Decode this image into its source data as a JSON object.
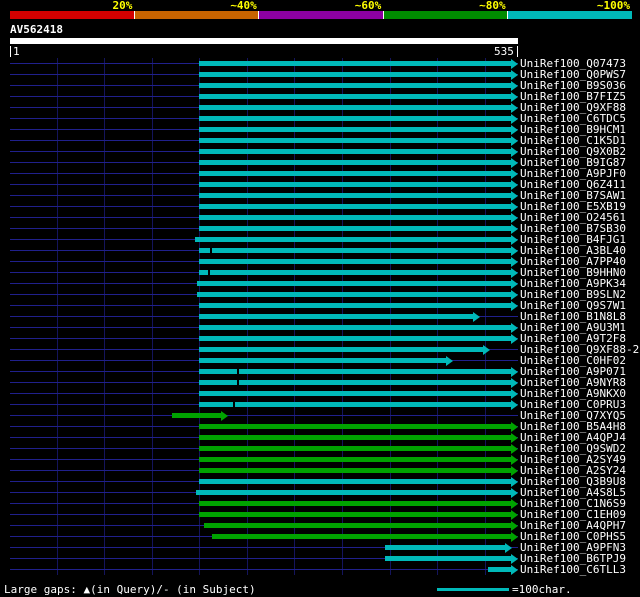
{
  "colors": {
    "background": "#000000",
    "bar_cyan": "#00b9b9",
    "bar_green": "#00a300",
    "backbone_line": "#20208c",
    "gridline": "#14145c",
    "scale_label": "#ffff00",
    "ruler": "#ffffff",
    "text": "#ffffff"
  },
  "footer": {
    "gaps_note": "Large gaps: ▲(in Query)/- (in Subject)",
    "scale_legend": "=100char."
  },
  "chart_data": {
    "type": "bar",
    "subtype": "blast-alignment-overview",
    "title": "AV562418",
    "query": {
      "name": "AV562418",
      "start": 1,
      "end": 535,
      "start_label": "1",
      "end_label": "535"
    },
    "x_range": [
      1,
      535
    ],
    "grid_interval": 50,
    "legend_unit_chars": 100,
    "identity_scale": [
      {
        "label": "20%",
        "color": "#d40000"
      },
      {
        "label": "~40%",
        "color": "#c86400"
      },
      {
        "label": "~60%",
        "color": "#8c00a0"
      },
      {
        "label": "~80%",
        "color": "#008c00"
      },
      {
        "label": "~100%",
        "color": "#00b9b9"
      }
    ],
    "hits": [
      {
        "label": "UniRef100_Q07473",
        "color": "cyan",
        "from": 200,
        "to": 535
      },
      {
        "label": "UniRef100_Q0PWS7",
        "color": "cyan",
        "from": 200,
        "to": 535
      },
      {
        "label": "UniRef100_B9S036",
        "color": "cyan",
        "from": 200,
        "to": 535
      },
      {
        "label": "UniRef100_B7FIZ5",
        "color": "cyan",
        "from": 200,
        "to": 535
      },
      {
        "label": "UniRef100_Q9XF88",
        "color": "cyan",
        "from": 200,
        "to": 535
      },
      {
        "label": "UniRef100_C6TDC5",
        "color": "cyan",
        "from": 200,
        "to": 535
      },
      {
        "label": "UniRef100_B9HCM1",
        "color": "cyan",
        "from": 200,
        "to": 535
      },
      {
        "label": "UniRef100_C1K5D1",
        "color": "cyan",
        "from": 200,
        "to": 535
      },
      {
        "label": "UniRef100_Q9X0B2",
        "color": "cyan",
        "from": 200,
        "to": 535
      },
      {
        "label": "UniRef100_B9IG87",
        "color": "cyan",
        "from": 200,
        "to": 535
      },
      {
        "label": "UniRef100_A9PJF0",
        "color": "cyan",
        "from": 200,
        "to": 535
      },
      {
        "label": "UniRef100_Q6Z411",
        "color": "cyan",
        "from": 200,
        "to": 535
      },
      {
        "label": "UniRef100_B7SAW1",
        "color": "cyan",
        "from": 200,
        "to": 535
      },
      {
        "label": "UniRef100_E5XB19",
        "color": "cyan",
        "from": 200,
        "to": 535
      },
      {
        "label": "UniRef100_O24561",
        "color": "cyan",
        "from": 200,
        "to": 535
      },
      {
        "label": "UniRef100_B7SB30",
        "color": "cyan",
        "from": 200,
        "to": 535
      },
      {
        "label": "UniRef100_B4FJG1",
        "color": "cyan",
        "from": 195,
        "to": 535
      },
      {
        "label": "UniRef100_A3BL40",
        "color": "cyan",
        "from": 200,
        "to": 535,
        "gaps": [
          211
        ]
      },
      {
        "label": "UniRef100_A7PP40",
        "color": "cyan",
        "from": 200,
        "to": 535
      },
      {
        "label": "UniRef100_B9HHN0",
        "color": "cyan",
        "from": 200,
        "to": 535,
        "gaps": [
          209
        ]
      },
      {
        "label": "UniRef100_A9PK34",
        "color": "cyan",
        "from": 197,
        "to": 535
      },
      {
        "label": "UniRef100_B9SLN2",
        "color": "cyan",
        "from": 197,
        "to": 535
      },
      {
        "label": "UniRef100_Q9S7W1",
        "color": "cyan",
        "from": 200,
        "to": 535
      },
      {
        "label": "UniRef100_B1N8L8",
        "color": "cyan",
        "from": 200,
        "to": 495
      },
      {
        "label": "UniRef100_A9U3M1",
        "color": "cyan",
        "from": 200,
        "to": 535
      },
      {
        "label": "UniRef100_A9T2F8",
        "color": "cyan",
        "from": 200,
        "to": 535
      },
      {
        "label": "UniRef100_Q9XF88-2",
        "color": "cyan",
        "from": 200,
        "to": 506
      },
      {
        "label": "UniRef100_C0HF02",
        "color": "cyan",
        "from": 200,
        "to": 467
      },
      {
        "label": "UniRef100_A9P071",
        "color": "cyan",
        "from": 200,
        "to": 535,
        "gaps": [
          240
        ]
      },
      {
        "label": "UniRef100_A9NYR8",
        "color": "cyan",
        "from": 200,
        "to": 535,
        "gaps": [
          240
        ]
      },
      {
        "label": "UniRef100_A9NKX0",
        "color": "cyan",
        "from": 200,
        "to": 535
      },
      {
        "label": "UniRef100_C0PRU3",
        "color": "cyan",
        "from": 200,
        "to": 535,
        "gaps": [
          235
        ]
      },
      {
        "label": "UniRef100_Q7XYQ5",
        "color": "green",
        "from": 171,
        "to": 230
      },
      {
        "label": "UniRef100_B5A4H8",
        "color": "green",
        "from": 200,
        "to": 535
      },
      {
        "label": "UniRef100_A4QPJ4",
        "color": "green",
        "from": 200,
        "to": 535
      },
      {
        "label": "UniRef100_Q9SWD2",
        "color": "green",
        "from": 200,
        "to": 535
      },
      {
        "label": "UniRef100_A2SY49",
        "color": "green",
        "from": 200,
        "to": 535
      },
      {
        "label": "UniRef100_A2SY24",
        "color": "green",
        "from": 200,
        "to": 535
      },
      {
        "label": "UniRef100_Q3B9U8",
        "color": "cyan",
        "from": 200,
        "to": 535
      },
      {
        "label": "UniRef100_A4S8L5",
        "color": "cyan",
        "from": 196,
        "to": 535
      },
      {
        "label": "UniRef100_C1N6S9",
        "color": "green",
        "from": 200,
        "to": 535
      },
      {
        "label": "UniRef100_C1EH09",
        "color": "green",
        "from": 200,
        "to": 535
      },
      {
        "label": "UniRef100_A4QPH7",
        "color": "green",
        "from": 205,
        "to": 535
      },
      {
        "label": "UniRef100_C0PHS5",
        "color": "green",
        "from": 213,
        "to": 535
      },
      {
        "label": "UniRef100_A9PFN3",
        "color": "cyan",
        "from": 395,
        "to": 529
      },
      {
        "label": "UniRef100_B6TPJ9",
        "color": "cyan",
        "from": 395,
        "to": 535
      },
      {
        "label": "UniRef100_C6TLL3",
        "color": "cyan",
        "from": 503,
        "to": 535
      }
    ]
  }
}
